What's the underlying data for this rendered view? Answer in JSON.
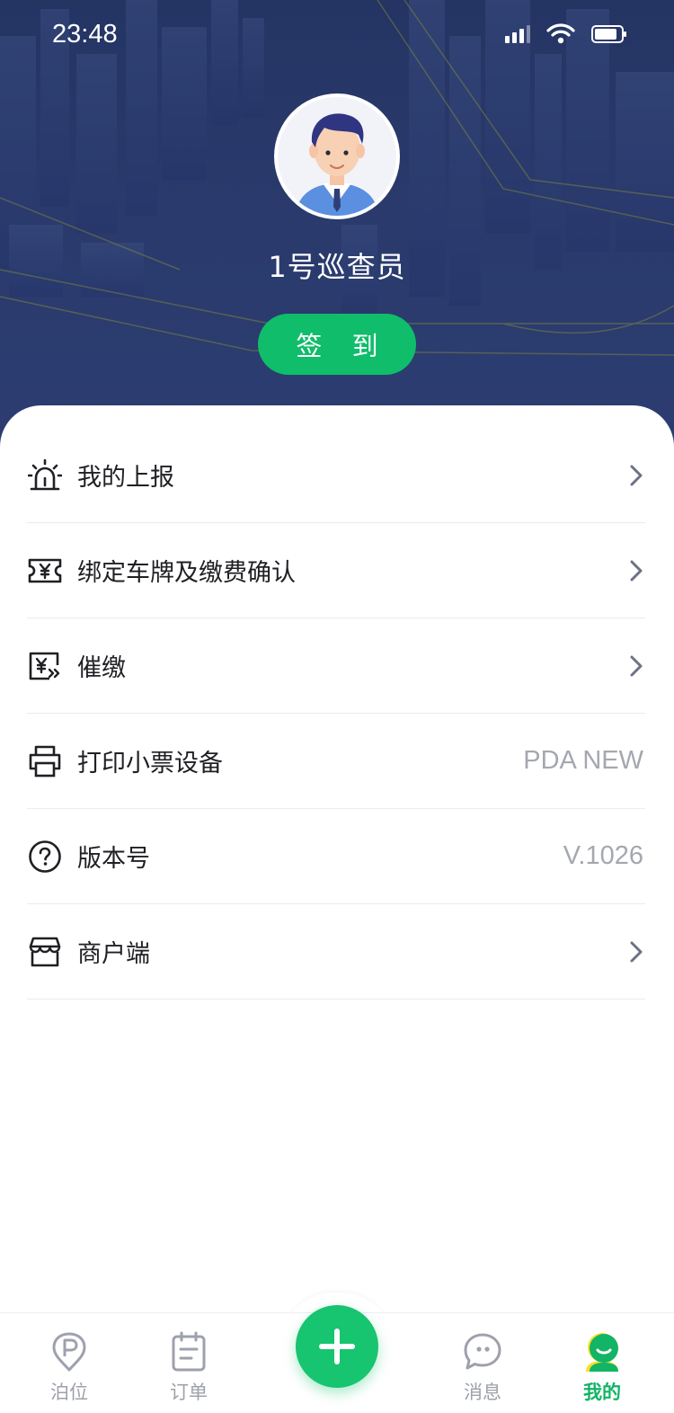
{
  "status_bar": {
    "time": "23:48"
  },
  "profile": {
    "name": "1号巡查员",
    "checkin_label": "签 到"
  },
  "menu": [
    {
      "label": "我的上报",
      "icon": "alarm-icon",
      "value": "",
      "has_arrow": true
    },
    {
      "label": "绑定车牌及缴费确认",
      "icon": "ticket-yuan-icon",
      "value": "",
      "has_arrow": true
    },
    {
      "label": "催缴",
      "icon": "payment-reminder-icon",
      "value": "",
      "has_arrow": true
    },
    {
      "label": "打印小票设备",
      "icon": "printer-icon",
      "value": "PDA NEW",
      "has_arrow": false
    },
    {
      "label": "版本号",
      "icon": "help-icon",
      "value": "V.1026",
      "has_arrow": false
    },
    {
      "label": "商户端",
      "icon": "store-icon",
      "value": "",
      "has_arrow": true
    }
  ],
  "tabbar": {
    "tabs": [
      {
        "label": "泊位",
        "icon": "parking-pin-icon",
        "active": false
      },
      {
        "label": "订单",
        "icon": "order-clipboard-icon",
        "active": false
      },
      {
        "label": "消息",
        "icon": "message-bubble-icon",
        "active": false
      },
      {
        "label": "我的",
        "icon": "user-face-icon",
        "active": true
      }
    ],
    "center_button_icon": "plus-icon"
  },
  "colors": {
    "accent": "#0fbd6a",
    "hero_bg": "#2a3a6c",
    "text_primary": "#1f1f24",
    "text_secondary": "#a5a7b0",
    "tab_inactive": "#9ea1ac",
    "tab_active": "#12b465"
  }
}
